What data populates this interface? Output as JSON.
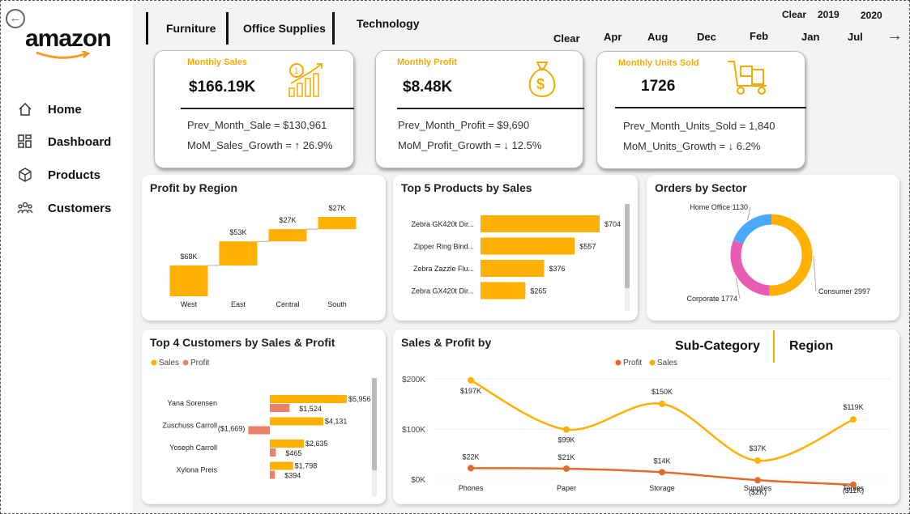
{
  "sidebar": {
    "logo": "amazon",
    "items": [
      {
        "label": "Home",
        "icon": "home-icon"
      },
      {
        "label": "Dashboard",
        "icon": "dashboard-icon"
      },
      {
        "label": "Products",
        "icon": "box-icon"
      },
      {
        "label": "Customers",
        "icon": "users-icon"
      }
    ]
  },
  "tabs": [
    "Furniture",
    "Office Supplies",
    "Technology"
  ],
  "slicers": {
    "clear": "Clear",
    "years": [
      "2019",
      "2020"
    ],
    "months_top": [
      "Apr",
      "Aug",
      "Dec",
      "Feb"
    ],
    "months_bottom": [
      "Jan",
      "Jul"
    ],
    "clear_top": "Clear"
  },
  "kpis": [
    {
      "title": "Monthly Sales",
      "value": "$166.19K",
      "prev": "Prev_Month_Sale = $130,961",
      "growth": "MoM_Sales_Growth = ↑ 26.9%",
      "icon": "growth-chart-icon"
    },
    {
      "title": "Monthly Profit",
      "value": "$8.48K",
      "prev": "Prev_Month_Profit = $9,690",
      "growth": "MoM_Profit_Growth = ↓ 12.5%",
      "icon": "money-bag-icon"
    },
    {
      "title": "Monthly Units Sold",
      "value": "1726",
      "prev": "Prev_Month_Units_Sold = 1,840",
      "growth": "MoM_Units_Growth = ↓ 6.2%",
      "icon": "hand-truck-icon"
    }
  ],
  "colors": {
    "accent": "#ffb000",
    "profit": "#e06c2c",
    "profit_bar": "#e8826a",
    "pink": "#e85cb4",
    "blue": "#4aa8ff"
  },
  "profit_region": {
    "title": "Profit by Region",
    "chart_data": {
      "type": "bar",
      "subtype": "waterfall",
      "categories": [
        "West",
        "East",
        "Central",
        "South"
      ],
      "values": [
        68,
        53,
        27,
        27
      ],
      "labels": [
        "$68K",
        "$53K",
        "$27K",
        "$27K"
      ]
    }
  },
  "top_products": {
    "title": "Top 5 Products by Sales",
    "chart_data": {
      "type": "bar",
      "orientation": "horizontal",
      "categories": [
        "Zebra GK420t Dir...",
        "Zipper Ring Bind...",
        "Zebra Zazzle Flu...",
        "Zebra GX420t Dir..."
      ],
      "values": [
        704,
        557,
        376,
        265
      ],
      "labels": [
        "$704",
        "$557",
        "$376",
        "$265"
      ]
    }
  },
  "orders_sector": {
    "title": "Orders by Sector",
    "chart_data": {
      "type": "pie",
      "subtype": "donut",
      "categories": [
        "Consumer",
        "Corporate",
        "Home Office"
      ],
      "values": [
        2997,
        1774,
        1130
      ],
      "labels": [
        "Consumer 2997",
        "Corporate 1774",
        "Home Office 1130"
      ]
    }
  },
  "top_customers": {
    "title": "Top 4 Customers by Sales & Profit",
    "legend": [
      "Sales",
      "Profit"
    ],
    "chart_data": {
      "type": "bar",
      "orientation": "horizontal",
      "categories": [
        "Yana Sorensen",
        "Zuschuss Carroll",
        "Yoseph Carroll",
        "Xylona Preis"
      ],
      "series": [
        {
          "name": "Sales",
          "values": [
            5956,
            4131,
            2635,
            1798
          ],
          "labels": [
            "$5,956",
            "$4,131",
            "$2,635",
            "$1,798"
          ]
        },
        {
          "name": "Profit",
          "values": [
            1524,
            -1669,
            465,
            394
          ],
          "labels": [
            "$1,524",
            "($1,669)",
            "$465",
            "$394"
          ]
        }
      ]
    }
  },
  "sales_profit": {
    "title": "Sales & Profit by",
    "toggle": [
      "Sub-Category",
      "Region"
    ],
    "legend": [
      "Profit",
      "Sales"
    ],
    "chart_data": {
      "type": "line",
      "categories": [
        "Phones",
        "Paper",
        "Storage",
        "Supplies",
        "Tables"
      ],
      "series": [
        {
          "name": "Sales",
          "values": [
            197,
            99,
            150,
            37,
            119
          ],
          "labels": [
            "$197K",
            "$99K",
            "$150K",
            "$37K",
            "$119K"
          ]
        },
        {
          "name": "Profit",
          "values": [
            22,
            21,
            14,
            -2,
            -11
          ],
          "labels": [
            "$22K",
            "$21K",
            "$14K",
            "($2K)",
            "($11K)"
          ]
        }
      ],
      "yticks": [
        "$200K",
        "$100K",
        "$0K"
      ],
      "ylim": [
        0,
        200
      ]
    }
  }
}
